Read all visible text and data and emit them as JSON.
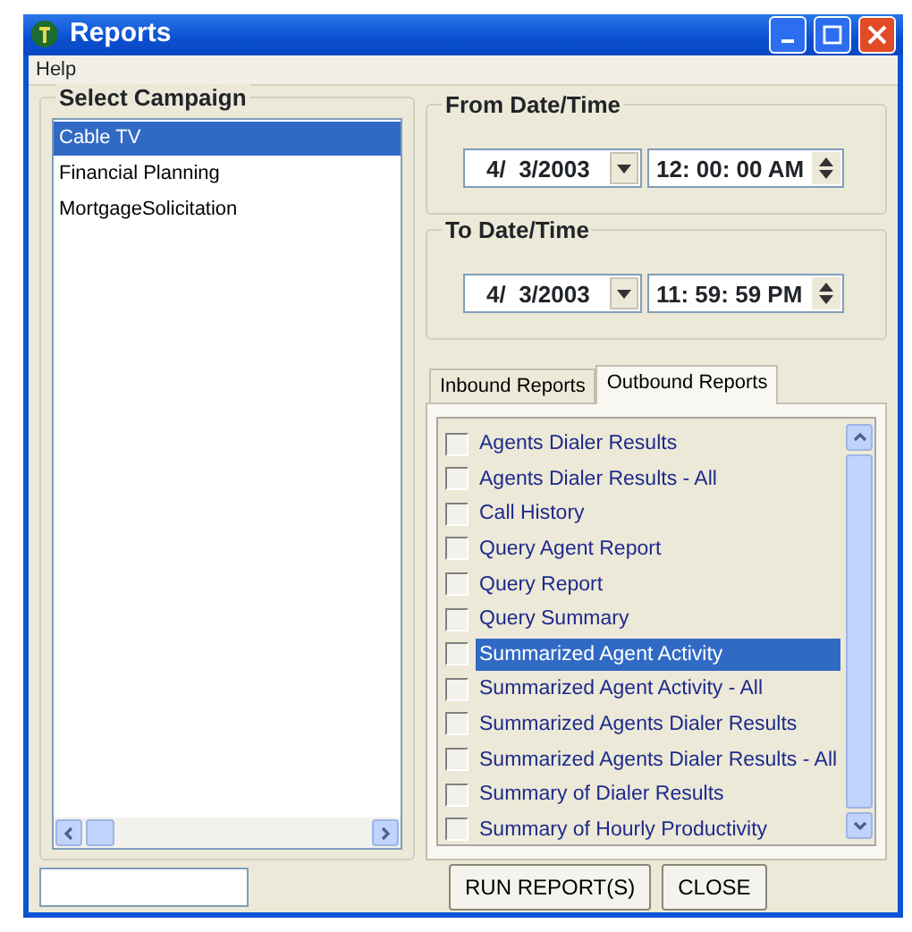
{
  "window": {
    "title": "Reports"
  },
  "menu": [
    "Help"
  ],
  "campaign_group": {
    "title": "Select Campaign",
    "items": [
      {
        "label": "Cable TV",
        "selected": true
      },
      {
        "label": "Financial Planning",
        "selected": false
      },
      {
        "label": "MortgageSolicitation",
        "selected": false
      }
    ]
  },
  "from": {
    "title": "From Date/Time",
    "date": "4/  3/2003",
    "time": "12: 00: 00 AM"
  },
  "to": {
    "title": "To Date/Time",
    "date": "4/  3/2003",
    "time": "11: 59: 59 PM"
  },
  "tabs": [
    {
      "label": "Inbound Reports",
      "selected": false
    },
    {
      "label": "Outbound Reports",
      "selected": true
    }
  ],
  "reports": [
    {
      "label": "Agents Dialer Results",
      "checked": false,
      "selected": false
    },
    {
      "label": "Agents Dialer Results - All",
      "checked": false,
      "selected": false
    },
    {
      "label": "Call History",
      "checked": false,
      "selected": false
    },
    {
      "label": "Query Agent Report",
      "checked": false,
      "selected": false
    },
    {
      "label": "Query Report",
      "checked": false,
      "selected": false
    },
    {
      "label": "Query Summary",
      "checked": false,
      "selected": false
    },
    {
      "label": "Summarized Agent Activity",
      "checked": false,
      "selected": true
    },
    {
      "label": "Summarized Agent Activity - All",
      "checked": false,
      "selected": false
    },
    {
      "label": "Summarized Agents Dialer Results",
      "checked": false,
      "selected": false
    },
    {
      "label": "Summarized Agents Dialer Results - All",
      "checked": false,
      "selected": false
    },
    {
      "label": "Summary of Dialer Results",
      "checked": false,
      "selected": false
    },
    {
      "label": "Summary of Hourly Productivity",
      "checked": false,
      "selected": false
    }
  ],
  "buttons": [
    "RUN REPORT(S)",
    "CLOSE"
  ]
}
